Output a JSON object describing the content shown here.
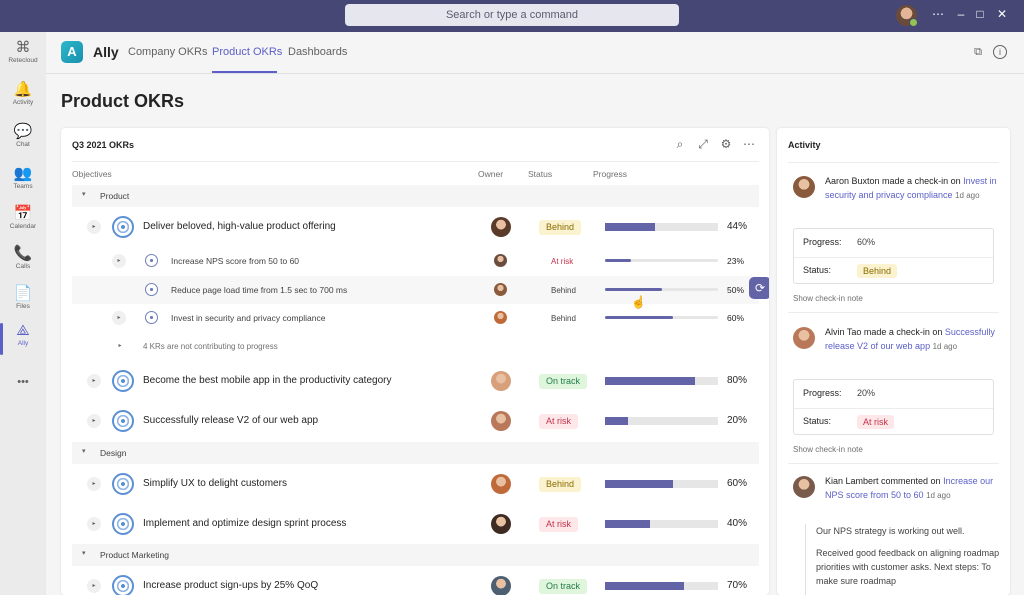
{
  "titlebar": {
    "search_placeholder": "Search or type a command"
  },
  "rail": [
    {
      "label": "Retecloud",
      "icon": "⌘"
    },
    {
      "label": "Activity",
      "icon": "🔔"
    },
    {
      "label": "Chat",
      "icon": "💬"
    },
    {
      "label": "Teams",
      "icon": "👥"
    },
    {
      "label": "Calendar",
      "icon": "📅"
    },
    {
      "label": "Calls",
      "icon": "📞"
    },
    {
      "label": "Files",
      "icon": "📄"
    },
    {
      "label": "Ally",
      "icon": "⟁"
    }
  ],
  "rail_more": "•••",
  "app": {
    "name": "Ally",
    "tabs": [
      "Company OKRs",
      "Product OKRs",
      "Dashboards"
    ],
    "active_tab": 1
  },
  "page_title": "Product OKRs",
  "panel": {
    "title": "Q3 2021 OKRs",
    "columns": {
      "objectives": "Objectives",
      "owner": "Owner",
      "status": "Status",
      "progress": "Progress"
    }
  },
  "groups": [
    "Product",
    "Design",
    "Product Marketing"
  ],
  "objectives": [
    {
      "text": "Deliver beloved, high-value product offering",
      "status": "Behind",
      "progress": 0.44,
      "pct": "44%"
    },
    {
      "text": "Become the best mobile app in the productivity category",
      "status": "On track",
      "progress": 0.8,
      "pct": "80%"
    },
    {
      "text": "Successfully release V2 of our web app",
      "status": "At risk",
      "progress": 0.2,
      "pct": "20%"
    },
    {
      "text": "Simplify UX to delight customers",
      "status": "Behind",
      "progress": 0.6,
      "pct": "60%"
    },
    {
      "text": "Implement and optimize design sprint process",
      "status": "At risk",
      "progress": 0.4,
      "pct": "40%"
    },
    {
      "text": "Increase product sign-ups by 25% QoQ",
      "status": "On track",
      "progress": 0.7,
      "pct": "70%"
    }
  ],
  "key_results": [
    {
      "text": "Increase NPS score from 50 to 60",
      "status": "At risk",
      "progress": 0.23,
      "pct": "23%"
    },
    {
      "text": "Reduce page load time from 1.5 sec to 700 ms",
      "status": "Behind",
      "progress": 0.5,
      "pct": "50%"
    },
    {
      "text": "Invest in security and privacy compliance",
      "status": "Behind",
      "progress": 0.6,
      "pct": "60%"
    }
  ],
  "kr_note": "4 KRs are not contributing to progress",
  "status_colors": {
    "Behind": {
      "bg": "#fbf2cf",
      "fg": "#8a6d00"
    },
    "On track": {
      "bg": "#dff6dd",
      "fg": "#237b4b"
    },
    "At risk": {
      "bg": "#fde7e9",
      "fg": "#c4314b"
    }
  },
  "activity": {
    "title": "Activity",
    "entries": [
      {
        "author": "Aaron Buxton",
        "action": " made a check-in on ",
        "target": "Invest in security and privacy compliance",
        "ago": "1d ago",
        "progress_label": "Progress:",
        "progress": "60%",
        "status_label": "Status:",
        "status": "Behind",
        "show_note": "Show check-in note"
      },
      {
        "author": "Alvin Tao",
        "action": " made a check-in on ",
        "target": "Successfully release V2 of our web app",
        "ago": "1d ago",
        "progress_label": "Progress:",
        "progress": "20%",
        "status_label": "Status:",
        "status": "At risk",
        "show_note": "Show check-in note"
      },
      {
        "author": "Kian Lambert",
        "action": " commented on ",
        "target": "Increase our NPS score from 50 to 60",
        "ago": "1d ago",
        "comment": [
          "Our NPS strategy is working out well.",
          "Received good feedback on aligning roadmap priorities with customer asks. Next steps: To make sure roadmap"
        ]
      }
    ]
  }
}
